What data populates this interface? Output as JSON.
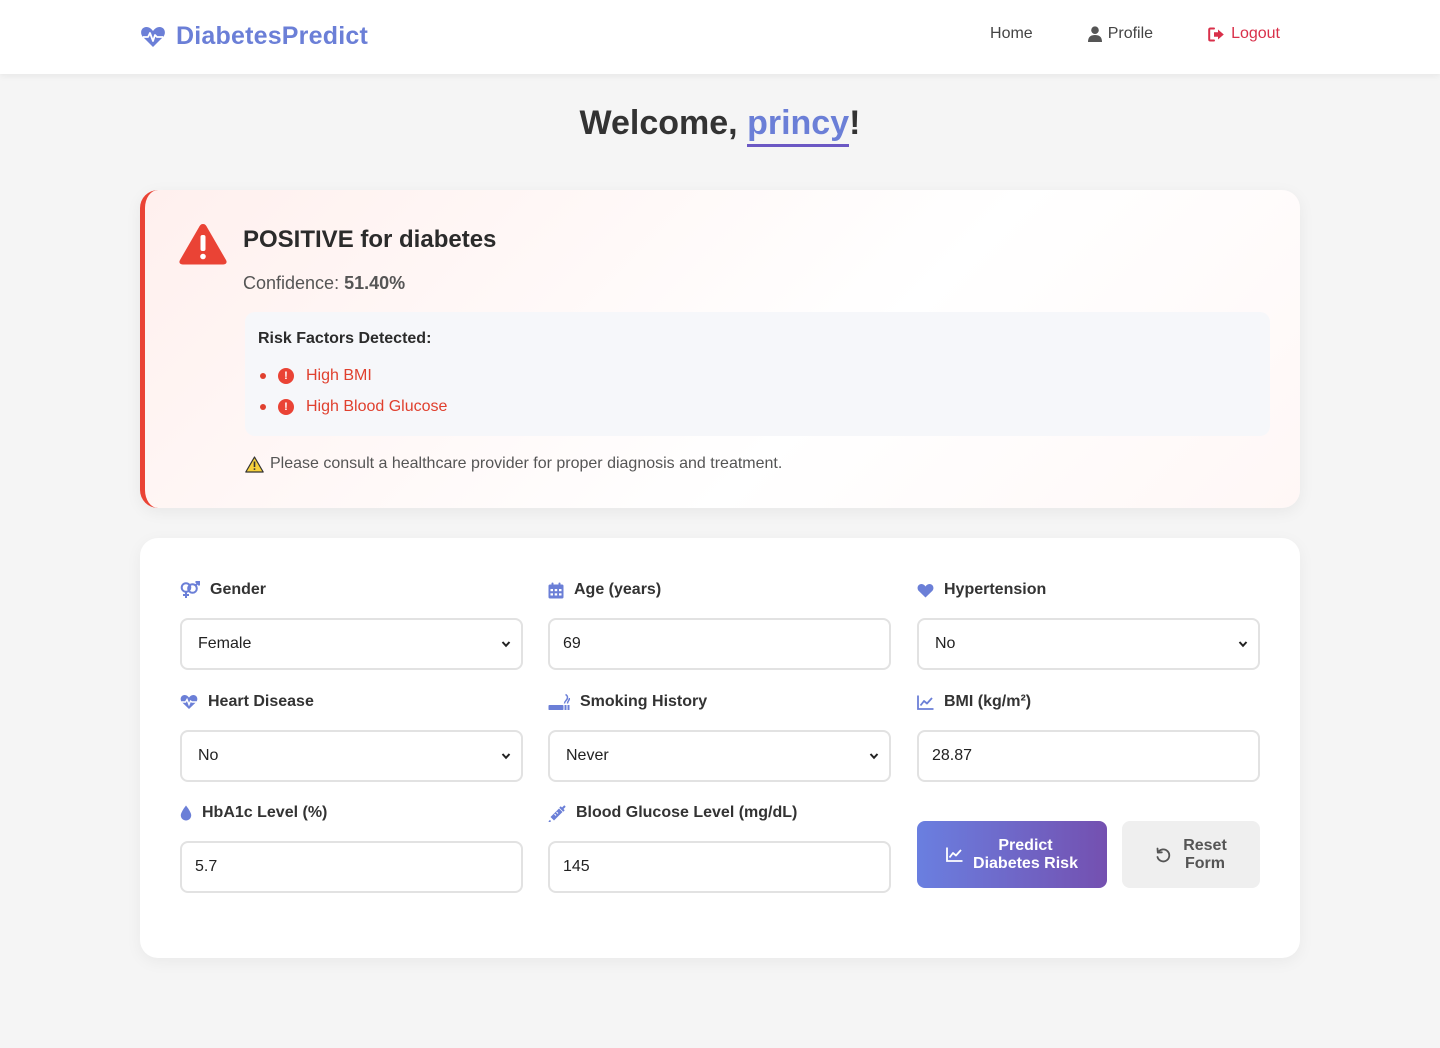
{
  "brand": {
    "name": "DiabetesPredict",
    "icon": "heartbeat-icon",
    "color": "#6b7fd7"
  },
  "nav": {
    "home": "Home",
    "profile": "Profile",
    "logout": "Logout",
    "logout_color": "#d9304a"
  },
  "welcome": {
    "prefix": "Welcome, ",
    "username": "princy",
    "suffix": "!"
  },
  "result": {
    "title": "POSITIVE for diabetes",
    "confidence_label": "Confidence: ",
    "confidence_value": "51.40%",
    "risk_title": "Risk Factors Detected:",
    "risk_factors": [
      "High BMI",
      "High Blood Glucose"
    ],
    "consult_note": "Please consult a healthcare provider for proper diagnosis and treatment.",
    "accent_color": "#ea4335"
  },
  "form": {
    "gender": {
      "label": "Gender",
      "value": "Female",
      "icon": "venus-mars-icon"
    },
    "age": {
      "label": "Age (years)",
      "value": "69",
      "icon": "calendar-icon"
    },
    "hypertension": {
      "label": "Hypertension",
      "value": "No",
      "icon": "heart-icon"
    },
    "heart_disease": {
      "label": "Heart Disease",
      "value": "No",
      "icon": "heartbeat-icon"
    },
    "smoking": {
      "label": "Smoking History",
      "value": "Never",
      "icon": "smoking-icon"
    },
    "bmi": {
      "label": "BMI (kg/m²)",
      "value": "28.87",
      "icon": "chart-line-icon"
    },
    "hba1c": {
      "label": "HbA1c Level (%)",
      "value": "5.7",
      "icon": "droplet-icon"
    },
    "glucose": {
      "label": "Blood Glucose Level (mg/dL)",
      "value": "145",
      "icon": "syringe-icon"
    },
    "predict_button": {
      "line1": "Predict",
      "line2": "Diabetes Risk"
    },
    "reset_button": {
      "line1": "Reset",
      "line2": "Form"
    }
  }
}
